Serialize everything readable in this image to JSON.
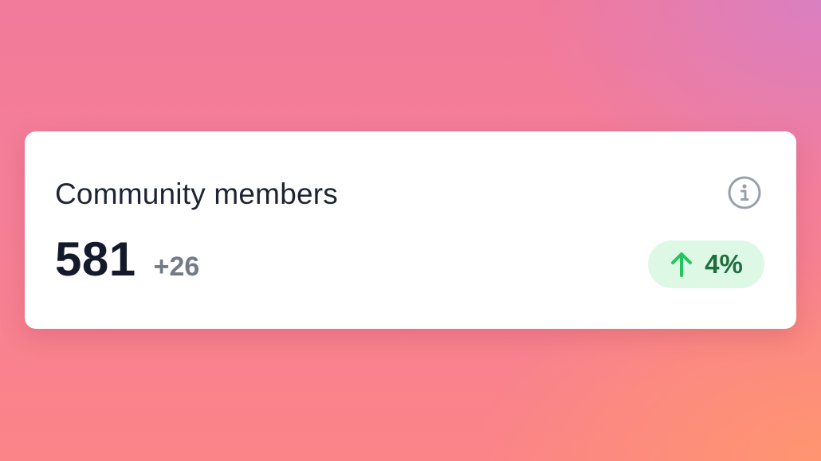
{
  "card": {
    "title": "Community members",
    "info_icon": "info-icon",
    "value": "581",
    "delta": "+26",
    "trend": {
      "direction": "up",
      "icon": "arrow-up-icon",
      "percent": "4%",
      "color": "#22c55e",
      "background": "#ddf9e6"
    }
  }
}
